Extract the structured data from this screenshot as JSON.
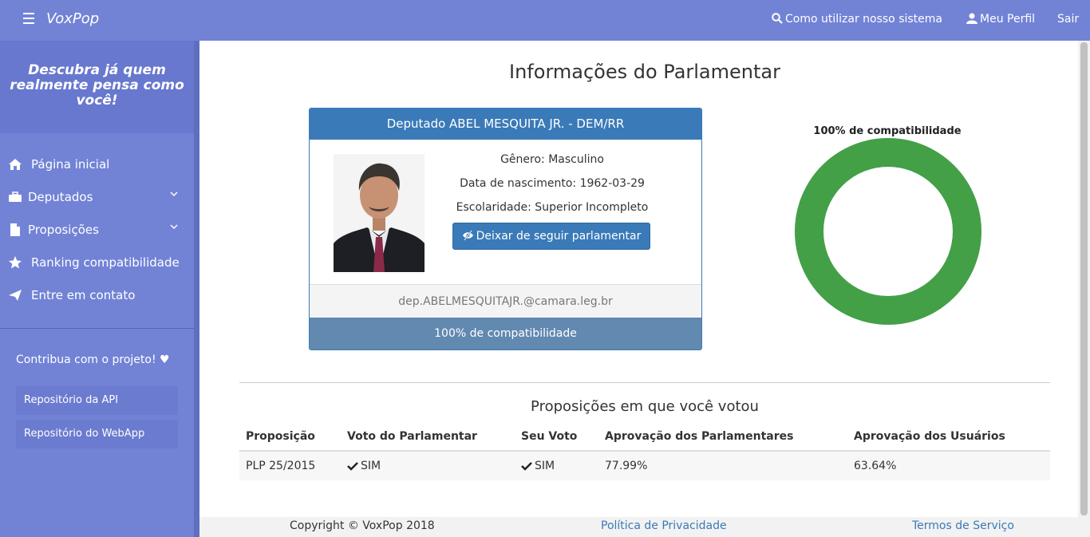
{
  "topbar": {
    "brand": "VoxPop",
    "help": "Como utilizar nosso sistema",
    "profile": "Meu Perfil",
    "logout": "Sair",
    "background": "#7283d6"
  },
  "sidebar": {
    "tagline": "Descubra já quem realmente pensa como você!",
    "items": [
      {
        "label": "Página inicial",
        "icon": "home-icon"
      },
      {
        "label": "Deputados",
        "icon": "briefcase-icon"
      },
      {
        "label": "Proposições",
        "icon": "file-icon"
      },
      {
        "label": "Ranking compatibilidade",
        "icon": "star-icon"
      },
      {
        "label": "Entre em contato",
        "icon": "send-icon"
      }
    ],
    "contribute": "Contribua com o projeto! ♥",
    "repo_api": "Repositório da API",
    "repo_webapp": "Repositório do WebApp"
  },
  "main": {
    "title": "Informações do Parlamentar",
    "card": {
      "header": "Deputado ABEL MESQUITA JR. - DEM/RR",
      "gender": "Gênero: Masculino",
      "birth": "Data de nascimento: 1962-03-29",
      "education": "Escolaridade: Superior Incompleto",
      "follow_button": "Deixar de seguir parlamentar",
      "email": "dep.ABELMESQUITAJR.@camara.leg.br",
      "footer": "100% de compatibilidade",
      "accent": "#3a7ab8"
    },
    "compat_chart": {
      "title": "100% de compatibilidade",
      "percent": 100,
      "color": "#43a047"
    },
    "votes": {
      "title": "Proposições em que você votou",
      "columns": [
        "Proposição",
        "Voto do Parlamentar",
        "Seu Voto",
        "Aprovação dos Parlamentares",
        "Aprovação dos Usuários"
      ],
      "rows": [
        {
          "proposition": "PLP 25/2015",
          "parl_vote": "SIM",
          "your_vote": "SIM",
          "parl_approval": "77.99%",
          "user_approval": "63.64%"
        }
      ]
    }
  },
  "footer": {
    "copyright": "Copyright © VoxPop 2018",
    "privacy": "Política de Privacidade",
    "terms": "Termos de Serviço"
  }
}
